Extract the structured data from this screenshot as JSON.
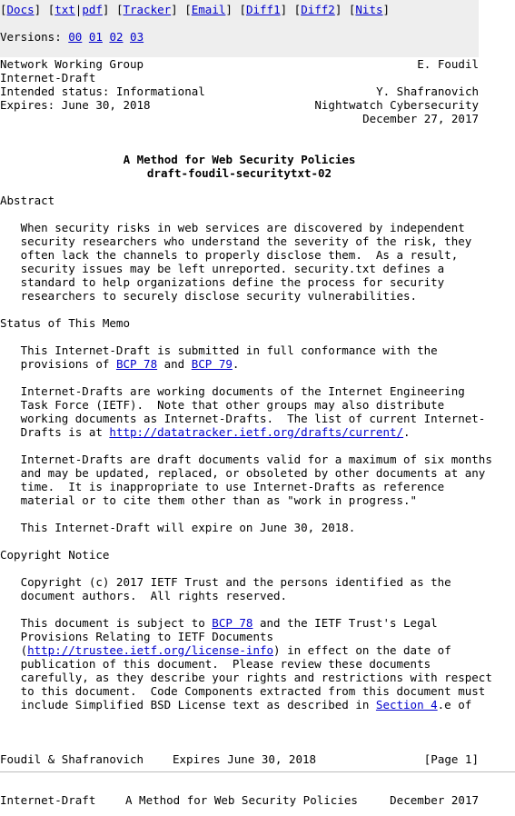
{
  "nav": {
    "docs": "Docs",
    "txt": "txt",
    "pdf": "pdf",
    "tracker": "Tracker",
    "email": "Email",
    "diff1": "Diff1",
    "diff2": "Diff2",
    "nits": "Nits",
    "versions_label": "Versions:",
    "versions": [
      "00",
      "01",
      "02",
      "03"
    ]
  },
  "header": {
    "group": "Network Working Group",
    "author1": "E. Foudil",
    "doc_type": "Internet-Draft",
    "status": "Intended status: Informational",
    "author2": "Y. Shafranovich",
    "expires": "Expires: June 30, 2018",
    "org": "Nightwatch Cybersecurity",
    "date": "December 27, 2017"
  },
  "title": {
    "main": "A Method for Web Security Policies",
    "draft": "draft-foudil-securitytxt-02"
  },
  "abstract": {
    "heading": "Abstract",
    "lines": [
      "   When security risks in web services are discovered by independent",
      "   security researchers who understand the severity of the risk, they",
      "   often lack the channels to properly disclose them.  As a result,",
      "   security issues may be left unreported. security.txt defines a",
      "   standard to help organizations define the process for security",
      "   researchers to securely disclose security vulnerabilities."
    ]
  },
  "status_memo": {
    "heading": "Status of This Memo",
    "p1_line1": "   This Internet-Draft is submitted in full conformance with the",
    "p1_line2_pre": "   provisions of ",
    "bcp78": "BCP 78",
    "and": " and ",
    "bcp79": "BCP 79",
    "period": ".",
    "p2_lines": [
      "   Internet-Drafts are working documents of the Internet Engineering",
      "   Task Force (IETF).  Note that other groups may also distribute",
      "   working documents as Internet-Drafts.  The list of current Internet-"
    ],
    "p2_last_pre": "   Drafts is at ",
    "drafts_url": "http://datatracker.ietf.org/drafts/current/",
    "p3_lines": [
      "   Internet-Drafts are draft documents valid for a maximum of six months",
      "   and may be updated, replaced, or obsoleted by other documents at any",
      "   time.  It is inappropriate to use Internet-Drafts as reference",
      "   material or to cite them other than as \"work in progress.\""
    ],
    "expire_line": "   This Internet-Draft will expire on June 30, 2018."
  },
  "copyright": {
    "heading": "Copyright Notice",
    "p1_lines": [
      "   Copyright (c) 2017 IETF Trust and the persons identified as the",
      "   document authors.  All rights reserved."
    ],
    "p2_l1_pre": "   This document is subject to ",
    "bcp78": "BCP 78",
    "p2_l1_post": " and the IETF Trust's Legal",
    "p2_l2": "   Provisions Relating to IETF Documents",
    "p2_l3_pre": "   (",
    "license_url": "http://trustee.ietf.org/license-info",
    "p2_l3_post": ") in effect on the date of",
    "p2_mid_lines": [
      "   publication of this document.  Please review these documents",
      "   carefully, as they describe your rights and restrictions with respect",
      "   to this document.  Code Components extracted from this document must"
    ],
    "p2_last_pre": "   include Simplified BSD License text as described in ",
    "section_link": "Section 4",
    "p2_last_post": ".e of"
  },
  "footer": {
    "authors": "Foudil & Shafranovich",
    "expires": "Expires June 30, 2018",
    "page": "[Page 1]"
  },
  "next_header": {
    "left": "Internet-Draft",
    "center": "A Method for Web Security Policies",
    "right": "December 2017"
  }
}
